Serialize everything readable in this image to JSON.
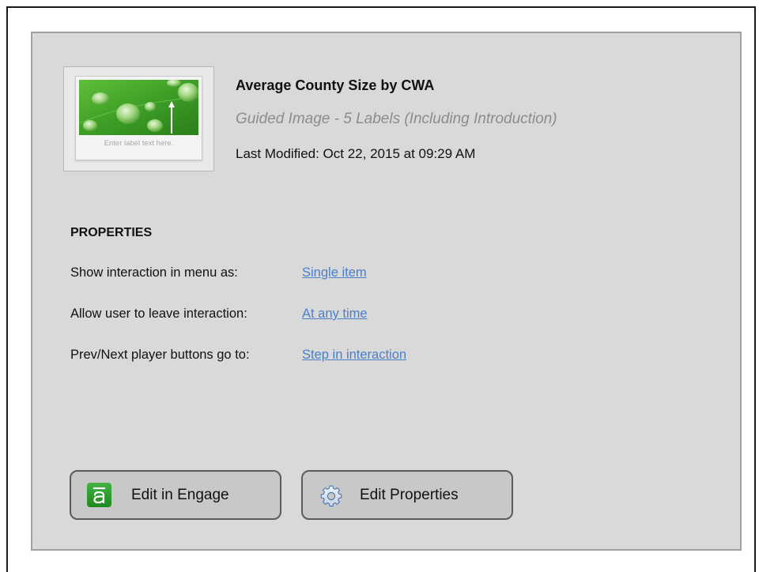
{
  "interaction": {
    "title": "Average County Size by CWA",
    "subtitle": "Guided Image - 5 Labels (Including Introduction)",
    "last_modified": "Last Modified: Oct 22, 2015 at 09:29 AM",
    "thumbnail_caption": "Enter label text here."
  },
  "properties": {
    "heading": "PROPERTIES",
    "items": [
      {
        "label": "Show interaction in menu as:",
        "value": "Single item"
      },
      {
        "label": "Allow user to leave interaction:",
        "value": "At any time"
      },
      {
        "label": "Prev/Next player buttons go to:",
        "value": "Step in interaction"
      }
    ]
  },
  "buttons": {
    "edit_engage": {
      "label": "Edit in Engage",
      "icon": "engage-icon"
    },
    "edit_properties": {
      "label": "Edit Properties",
      "icon": "gear-icon"
    }
  },
  "colors": {
    "panel_bg": "#d9d9d9",
    "link": "#4a7fc8",
    "subtitle": "#8c8c8c",
    "engage_green": "#2e9e2e"
  }
}
